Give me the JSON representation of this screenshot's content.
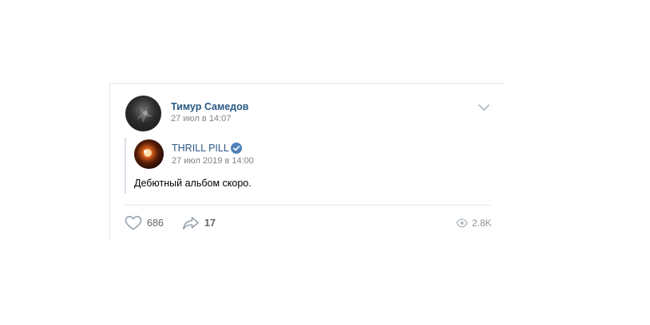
{
  "post": {
    "author_name": "Тимур Самедов",
    "author_date": "27 июл в 14:07",
    "menu_icon": "chevron-down-icon",
    "repost": {
      "source_name": "THRILL PILL",
      "source_verified": true,
      "source_date": "27 июл 2019 в 14:00",
      "text": "Дебютный альбом скоро."
    },
    "actions": {
      "likes": "686",
      "shares": "17",
      "views": "2.8K"
    }
  },
  "colors": {
    "link": "#2a5885",
    "muted": "#828282",
    "verified": "#5181b8",
    "divider": "#e7e8ec"
  }
}
